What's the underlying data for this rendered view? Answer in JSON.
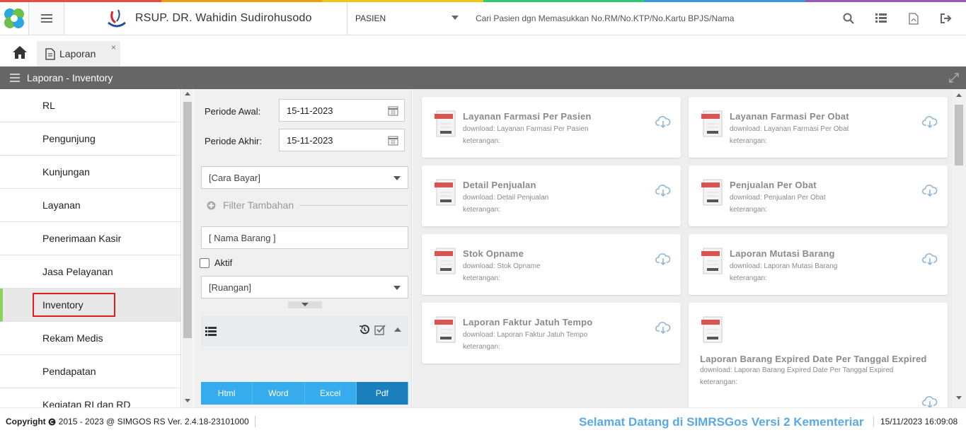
{
  "theme": {
    "accent": "#36acec",
    "active_export": "#1a7fbc",
    "titlebar": "#666666",
    "highlight": "#e01e1e",
    "active_marker": "#8bd35a"
  },
  "header": {
    "hospital_name": "RSUP. DR. Wahidin Sudirohusodo",
    "patient_select": "PASIEN",
    "search_placeholder": "Cari Pasien dgn Memasukkan No.RM/No.KTP/No.Kartu BPJS/Nama",
    "icons": [
      "search-icon",
      "list-icon",
      "pdf-file-icon",
      "logout-icon"
    ]
  },
  "tabs": [
    {
      "label": "Laporan",
      "close": "×"
    }
  ],
  "page_title": "Laporan - Inventory",
  "sidebar": {
    "items": [
      {
        "label": "RL"
      },
      {
        "label": "Pengunjung"
      },
      {
        "label": "Kunjungan"
      },
      {
        "label": "Layanan"
      },
      {
        "label": "Penerimaan Kasir"
      },
      {
        "label": "Jasa Pelayanan"
      },
      {
        "label": "Inventory",
        "active": true
      },
      {
        "label": "Rekam Medis"
      },
      {
        "label": "Pendapatan"
      },
      {
        "label": "Kegiatan RI dan RD"
      }
    ]
  },
  "filter": {
    "periode_awal_label": "Periode Awal:",
    "periode_awal_value": "15-11-2023",
    "periode_akhir_label": "Periode Akhir:",
    "periode_akhir_value": "15-11-2023",
    "cara_bayar": "[Cara Bayar]",
    "filter_tambahan": "Filter Tambahan",
    "nama_barang_placeholder": "[ Nama Barang ]",
    "aktif_label": "Aktif",
    "ruangan": "[Ruangan]",
    "export_buttons": [
      "Html",
      "Word",
      "Excel",
      "Pdf"
    ],
    "active_export": "Pdf"
  },
  "reports": [
    {
      "title": "Layanan Farmasi Per Pasien",
      "download": "download: Layanan Farmasi Per Pasien",
      "keterangan": "keterangan:"
    },
    {
      "title": "Layanan Farmasi Per Obat",
      "download": "download: Layanan Farmasi Per Obat",
      "keterangan": "keterangan:"
    },
    {
      "title": "Detail Penjualan",
      "download": "download: Detail Penjualan",
      "keterangan": "keterangan:"
    },
    {
      "title": "Penjualan Per Obat",
      "download": "download: Penjualan Per Obat",
      "keterangan": "keterangan:"
    },
    {
      "title": "Stok Opname",
      "download": "download: Stok Opname",
      "keterangan": "keterangan:"
    },
    {
      "title": "Laporan Mutasi Barang",
      "download": "download: Laporan Mutasi Barang",
      "keterangan": "keterangan:"
    },
    {
      "title": "Laporan Faktur Jatuh Tempo",
      "download": "download: Laporan Faktur Jatuh Tempo",
      "keterangan": "keterangan:"
    },
    {
      "title": "Laporan Barang Expired Date Per Tanggal Expired",
      "download": "download: Laporan Barang Expired Date Per Tanggal Expired",
      "keterangan": "keterangan:"
    }
  ],
  "footer": {
    "copyright_bold": "Copyright",
    "copyright_text": "2015 - 2023 @ SIMGOS RS Ver. 2.4.18-23101000",
    "welcome": "Selamat Datang di SIMRSGos Versi 2 Kementeriar",
    "datetime": "15/11/2023 16:09:08"
  }
}
